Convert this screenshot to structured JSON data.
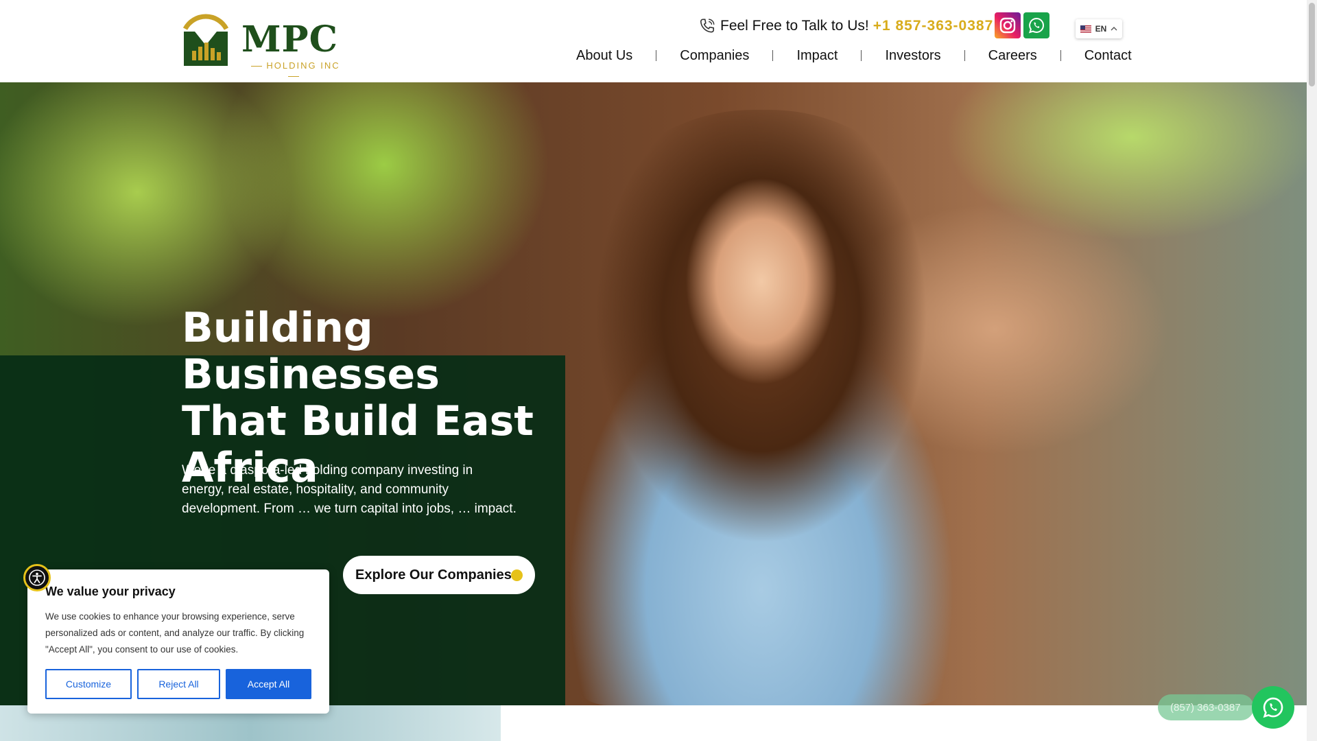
{
  "brand": {
    "name": "MPC",
    "subtitle": "HOLDING INC",
    "primary_color": "#1f4f1c",
    "gold_color": "#c9a227"
  },
  "header": {
    "contact_text": "Feel Free to Talk to Us!",
    "contact_phone": "+1 857-363-0387",
    "language": "EN",
    "nav": [
      {
        "label": "About Us"
      },
      {
        "label": "Companies"
      },
      {
        "label": "Impact"
      },
      {
        "label": "Investors"
      },
      {
        "label": "Careers"
      },
      {
        "label": "Contact"
      }
    ]
  },
  "hero": {
    "title": "Building Businesses That Build East Africa",
    "subtitle": "We’re a diaspora-led holding company investing in energy, real estate, hospitality, and community development. From … we turn capital into jobs, … impact.",
    "cta_label": "Explore Our Companies",
    "panel_color": "#062c16",
    "accent_color": "#e6c21a"
  },
  "cookie_banner": {
    "title": "We value your privacy",
    "text": "We use cookies to enhance your browsing experience, serve personalized ads or content, and analyze our traffic. By clicking \"Accept All\", you consent to our use of cookies.",
    "customize_label": "Customize",
    "reject_label": "Reject All",
    "accept_label": "Accept All",
    "button_color": "#1863dc"
  },
  "floating": {
    "whatsapp_phone": "(857) 363-0387",
    "whatsapp_color": "#22c55e"
  },
  "icons": [
    "phone-icon",
    "instagram-icon",
    "whatsapp-icon",
    "flag-us-icon",
    "chevron-up-icon",
    "accessibility-icon",
    "whatsapp-float-icon"
  ]
}
